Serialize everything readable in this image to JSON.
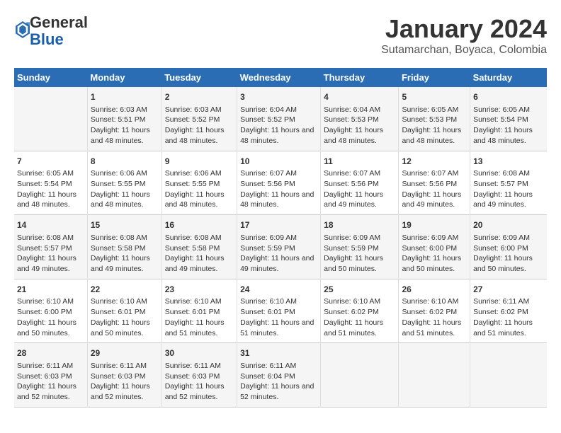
{
  "logo": {
    "general": "General",
    "blue": "Blue"
  },
  "header": {
    "title": "January 2024",
    "subtitle": "Sutamarchan, Boyaca, Colombia"
  },
  "weekdays": [
    "Sunday",
    "Monday",
    "Tuesday",
    "Wednesday",
    "Thursday",
    "Friday",
    "Saturday"
  ],
  "weeks": [
    [
      {
        "day": "",
        "info": ""
      },
      {
        "day": "1",
        "info": "Sunrise: 6:03 AM\nSunset: 5:51 PM\nDaylight: 11 hours and 48 minutes."
      },
      {
        "day": "2",
        "info": "Sunrise: 6:03 AM\nSunset: 5:52 PM\nDaylight: 11 hours and 48 minutes."
      },
      {
        "day": "3",
        "info": "Sunrise: 6:04 AM\nSunset: 5:52 PM\nDaylight: 11 hours and 48 minutes."
      },
      {
        "day": "4",
        "info": "Sunrise: 6:04 AM\nSunset: 5:53 PM\nDaylight: 11 hours and 48 minutes."
      },
      {
        "day": "5",
        "info": "Sunrise: 6:05 AM\nSunset: 5:53 PM\nDaylight: 11 hours and 48 minutes."
      },
      {
        "day": "6",
        "info": "Sunrise: 6:05 AM\nSunset: 5:54 PM\nDaylight: 11 hours and 48 minutes."
      }
    ],
    [
      {
        "day": "7",
        "info": "Sunrise: 6:05 AM\nSunset: 5:54 PM\nDaylight: 11 hours and 48 minutes."
      },
      {
        "day": "8",
        "info": "Sunrise: 6:06 AM\nSunset: 5:55 PM\nDaylight: 11 hours and 48 minutes."
      },
      {
        "day": "9",
        "info": "Sunrise: 6:06 AM\nSunset: 5:55 PM\nDaylight: 11 hours and 48 minutes."
      },
      {
        "day": "10",
        "info": "Sunrise: 6:07 AM\nSunset: 5:56 PM\nDaylight: 11 hours and 48 minutes."
      },
      {
        "day": "11",
        "info": "Sunrise: 6:07 AM\nSunset: 5:56 PM\nDaylight: 11 hours and 49 minutes."
      },
      {
        "day": "12",
        "info": "Sunrise: 6:07 AM\nSunset: 5:56 PM\nDaylight: 11 hours and 49 minutes."
      },
      {
        "day": "13",
        "info": "Sunrise: 6:08 AM\nSunset: 5:57 PM\nDaylight: 11 hours and 49 minutes."
      }
    ],
    [
      {
        "day": "14",
        "info": "Sunrise: 6:08 AM\nSunset: 5:57 PM\nDaylight: 11 hours and 49 minutes."
      },
      {
        "day": "15",
        "info": "Sunrise: 6:08 AM\nSunset: 5:58 PM\nDaylight: 11 hours and 49 minutes."
      },
      {
        "day": "16",
        "info": "Sunrise: 6:08 AM\nSunset: 5:58 PM\nDaylight: 11 hours and 49 minutes."
      },
      {
        "day": "17",
        "info": "Sunrise: 6:09 AM\nSunset: 5:59 PM\nDaylight: 11 hours and 49 minutes."
      },
      {
        "day": "18",
        "info": "Sunrise: 6:09 AM\nSunset: 5:59 PM\nDaylight: 11 hours and 50 minutes."
      },
      {
        "day": "19",
        "info": "Sunrise: 6:09 AM\nSunset: 6:00 PM\nDaylight: 11 hours and 50 minutes."
      },
      {
        "day": "20",
        "info": "Sunrise: 6:09 AM\nSunset: 6:00 PM\nDaylight: 11 hours and 50 minutes."
      }
    ],
    [
      {
        "day": "21",
        "info": "Sunrise: 6:10 AM\nSunset: 6:00 PM\nDaylight: 11 hours and 50 minutes."
      },
      {
        "day": "22",
        "info": "Sunrise: 6:10 AM\nSunset: 6:01 PM\nDaylight: 11 hours and 50 minutes."
      },
      {
        "day": "23",
        "info": "Sunrise: 6:10 AM\nSunset: 6:01 PM\nDaylight: 11 hours and 51 minutes."
      },
      {
        "day": "24",
        "info": "Sunrise: 6:10 AM\nSunset: 6:01 PM\nDaylight: 11 hours and 51 minutes."
      },
      {
        "day": "25",
        "info": "Sunrise: 6:10 AM\nSunset: 6:02 PM\nDaylight: 11 hours and 51 minutes."
      },
      {
        "day": "26",
        "info": "Sunrise: 6:10 AM\nSunset: 6:02 PM\nDaylight: 11 hours and 51 minutes."
      },
      {
        "day": "27",
        "info": "Sunrise: 6:11 AM\nSunset: 6:02 PM\nDaylight: 11 hours and 51 minutes."
      }
    ],
    [
      {
        "day": "28",
        "info": "Sunrise: 6:11 AM\nSunset: 6:03 PM\nDaylight: 11 hours and 52 minutes."
      },
      {
        "day": "29",
        "info": "Sunrise: 6:11 AM\nSunset: 6:03 PM\nDaylight: 11 hours and 52 minutes."
      },
      {
        "day": "30",
        "info": "Sunrise: 6:11 AM\nSunset: 6:03 PM\nDaylight: 11 hours and 52 minutes."
      },
      {
        "day": "31",
        "info": "Sunrise: 6:11 AM\nSunset: 6:04 PM\nDaylight: 11 hours and 52 minutes."
      },
      {
        "day": "",
        "info": ""
      },
      {
        "day": "",
        "info": ""
      },
      {
        "day": "",
        "info": ""
      }
    ]
  ]
}
